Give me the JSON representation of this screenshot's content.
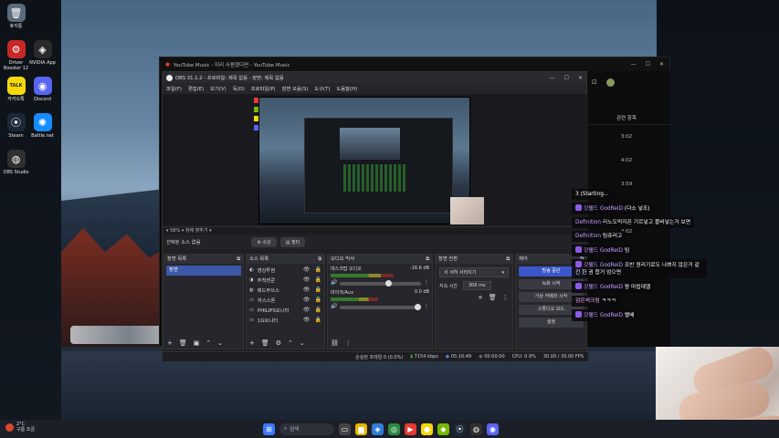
{
  "desktop_icons": [
    {
      "label": "휴지통",
      "icon": "recycle-bin-icon",
      "color": "#5b6b7a",
      "glyph": "🗑"
    },
    {
      "label": "Driver Booster 12",
      "icon": "driver-booster-icon",
      "color": "#c62828",
      "glyph": "⚙"
    },
    {
      "label": "NVIDIA App",
      "icon": "nvidia-icon",
      "color": "#2a2a2a",
      "glyph": "◈"
    },
    {
      "label": "카카오톡",
      "icon": "kakaotalk-icon",
      "color": "#f5d90a",
      "glyph": "TALK"
    },
    {
      "label": "Discord",
      "icon": "discord-icon",
      "color": "#5865f2",
      "glyph": "◉"
    },
    {
      "label": "Steam",
      "icon": "steam-icon",
      "color": "#1b2838",
      "glyph": "⦿"
    },
    {
      "label": "Battle.net",
      "icon": "battlenet-icon",
      "color": "#148eff",
      "glyph": "✺"
    },
    {
      "label": "OBS Studio",
      "icon": "obs-icon",
      "color": "#303030",
      "glyph": "◍"
    }
  ],
  "youtube_music": {
    "title": "YouTube Music - 미리 사용했다면 - YouTube Music",
    "queue_header": "관련 항목",
    "durations": [
      "3:02",
      "4:02",
      "3:59",
      "3:10",
      "4:02"
    ]
  },
  "obs": {
    "title": "OBS 31.1.2 - 프로파일: 제목 없음 - 장면: 제목 없음",
    "menu": [
      "파일(F)",
      "편집(E)",
      "보기(V)",
      "독(D)",
      "프로파일(P)",
      "장면 모음(S)",
      "도구(T)",
      "도움말(H)"
    ],
    "zoom_label": "▾  58%  ▾  창에 맞추기  ▾",
    "no_source_selected": "선택된 소스 없음",
    "properties_btn": "⚙ 속성",
    "filters_btn": "▤ 필터",
    "scenes_header": "장면 목록",
    "scenes": [
      "장면"
    ],
    "sources_header": "소스 목록",
    "sources": [
      {
        "name": "영상투썸",
        "icon": "video-icon"
      },
      {
        "name": "주척센쿤",
        "icon": "capture-icon"
      },
      {
        "name": "에드부쓰스",
        "icon": "gamepad-icon"
      },
      {
        "name": "하스스톤",
        "icon": "window-icon"
      },
      {
        "name": "PHILIPS모니터",
        "icon": "monitor-icon"
      },
      {
        "name": "1G모니터",
        "icon": "monitor-icon"
      }
    ],
    "mixer_header": "오디오 믹서",
    "mixer": [
      {
        "name": "데스크탑 오디오",
        "db": "-16.6 dB",
        "level": 0.64,
        "volume": 0.6
      },
      {
        "name": "마이크/Aux",
        "db": "0.0 dB",
        "level": 0.48,
        "volume": 0.97
      }
    ],
    "transitions_header": "장면 전환",
    "transition_type": "서 서히 사라지기",
    "duration_label": "지속 시간",
    "duration_value": "300 ms",
    "controls_header": "제어",
    "controls": [
      "방송 중단",
      "녹화 시작",
      "가상 카메라 시작",
      "스튜디오 모드",
      "설정"
    ],
    "status": {
      "dropped": "손실된 프레임 0 (0.0%)",
      "bitrate": "7154 kbps",
      "live_time": "05:16:49",
      "rec_time": "00:00:00",
      "cpu": "CPU: 0.9%",
      "fps": "30.00 / 30.00 FPS"
    }
  },
  "chat": [
    {
      "prefix": "",
      "name": "",
      "text": "3 (Starting..."
    },
    {
      "prefix": "badge",
      "name": "갓웰드 GodRelD",
      "text": "(다소 넣조)"
    },
    {
      "prefix": "",
      "name": "Definition",
      "text": "리노도먹지픈 기르넣고 플비넣는거 보면"
    },
    {
      "prefix": "",
      "name": "Definition",
      "text": "팀쥬러고"
    },
    {
      "prefix": "badge",
      "name": "갓웰드 GodRelD",
      "text": "팀"
    },
    {
      "prefix": "badge",
      "name": "갓웰드 GodRelD",
      "text": "조반 원리기로도 나쁘지 않은거 같긴 한 권 합거 엄으면"
    },
    {
      "prefix": "badge",
      "name": "갓웰드 GodRelD",
      "text": "왕 마됩데엘"
    },
    {
      "prefix": "",
      "name": "검은색크림",
      "text": "ㅋㅋㅋ"
    },
    {
      "prefix": "badge",
      "name": "갓웰드 GodRelD",
      "text": "빨배"
    }
  ],
  "taskbar": {
    "weather_temp": "2°C",
    "weather_desc": "구름 조금",
    "search_placeholder": "검색",
    "apps": [
      {
        "icon": "start-icon",
        "glyph": "⊞",
        "color": "#3a78ff"
      },
      {
        "icon": "taskview-icon",
        "glyph": "▭",
        "color": "#444"
      },
      {
        "icon": "file-explorer-icon",
        "glyph": "▆",
        "color": "#e8b400"
      },
      {
        "icon": "photos-icon",
        "glyph": "◈",
        "color": "#2f7bd6"
      },
      {
        "icon": "chrome-icon",
        "glyph": "◎",
        "color": "#2b8a3e"
      },
      {
        "icon": "youtube-music-icon",
        "glyph": "▶",
        "color": "#e53935"
      },
      {
        "icon": "kakaotalk-icon",
        "glyph": "●",
        "color": "#f5d90a"
      },
      {
        "icon": "nvidia-icon",
        "glyph": "◆",
        "color": "#76b900"
      },
      {
        "icon": "steam-icon",
        "glyph": "⦿",
        "color": "#1b2838"
      },
      {
        "icon": "obs-icon",
        "glyph": "◍",
        "color": "#303030"
      },
      {
        "icon": "discord-icon",
        "glyph": "◉",
        "color": "#5865f2"
      }
    ]
  }
}
